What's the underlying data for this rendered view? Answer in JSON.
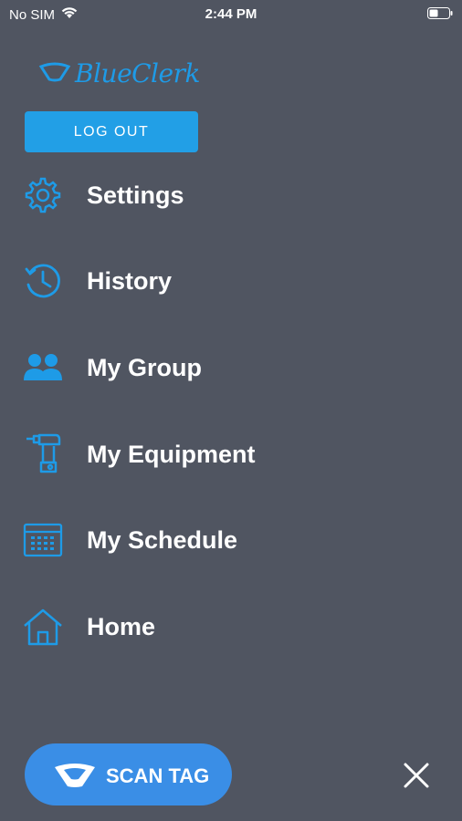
{
  "status_bar": {
    "carrier": "No SIM",
    "time": "2:44 PM",
    "wifi_icon": "wifi-icon",
    "battery_icon": "battery-icon"
  },
  "brand": {
    "logo_text": "BlueClerk",
    "accent_color": "#1e9be7"
  },
  "auth": {
    "logout_label": "LOG OUT"
  },
  "menu": {
    "items": [
      {
        "label": "Settings",
        "icon": "gear-icon"
      },
      {
        "label": "History",
        "icon": "history-icon"
      },
      {
        "label": "My Group",
        "icon": "group-icon"
      },
      {
        "label": "My Equipment",
        "icon": "drill-icon"
      },
      {
        "label": "My Schedule",
        "icon": "calendar-icon"
      },
      {
        "label": "Home",
        "icon": "home-icon"
      }
    ]
  },
  "actions": {
    "scan_label": "SCAN TAG",
    "close_icon": "close-icon"
  },
  "colors": {
    "background": "#505561",
    "button_blue": "#229fe6",
    "scan_blue": "#3a8ee6",
    "icon_blue": "#1e9be7"
  }
}
